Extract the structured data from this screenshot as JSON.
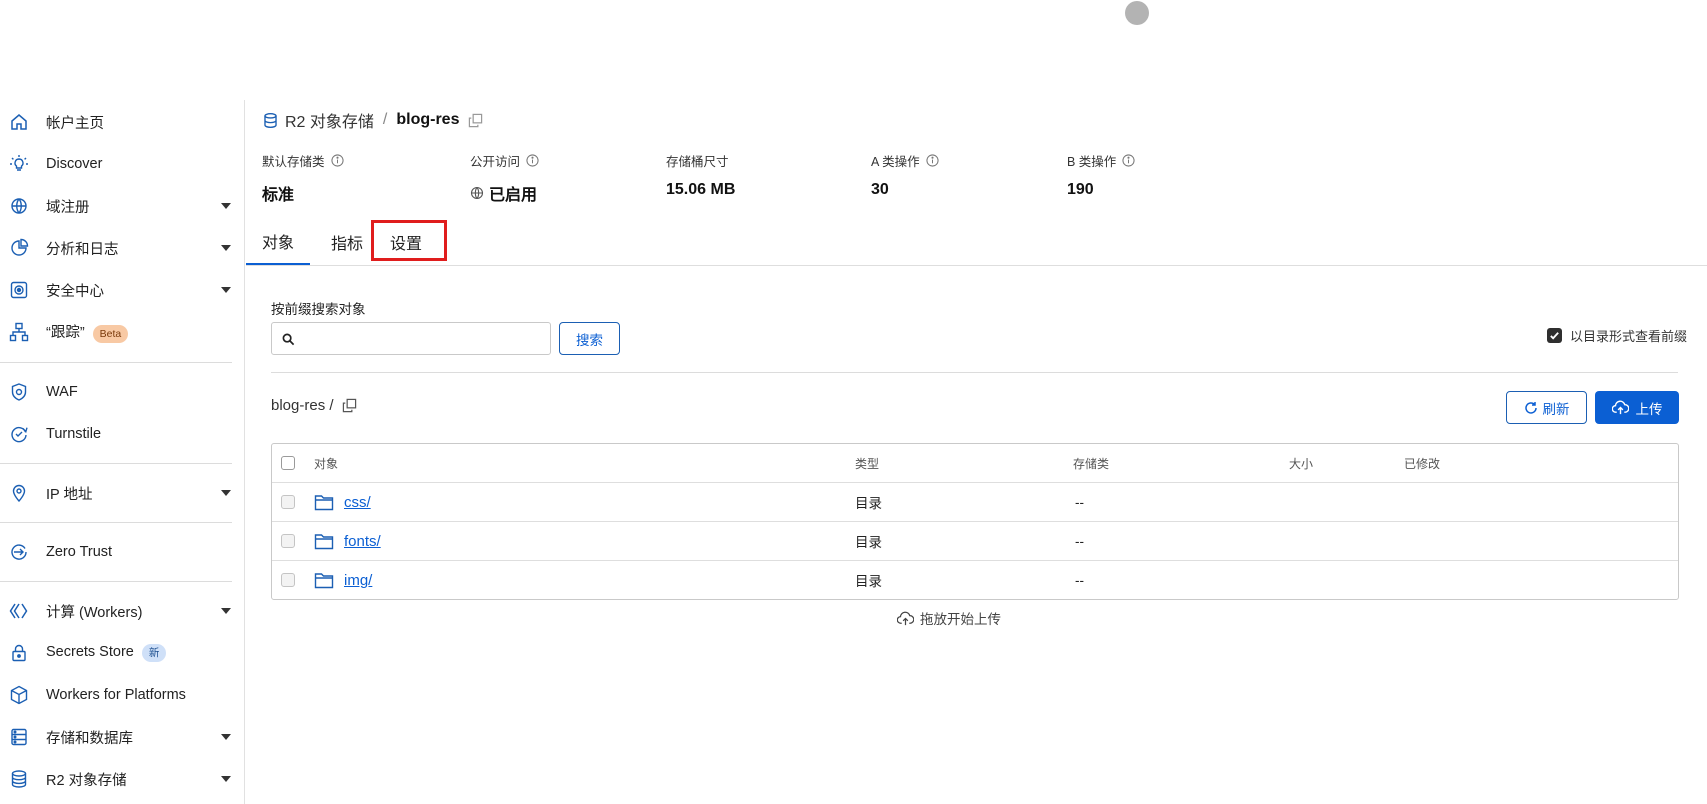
{
  "sidebar": {
    "items": [
      {
        "label": "帐户主页",
        "icon": "home-icon"
      },
      {
        "label": "Discover",
        "icon": "lightbulb-icon"
      },
      {
        "label": "域注册",
        "icon": "globe-icon"
      },
      {
        "label": "分析和日志",
        "icon": "pie-chart-icon"
      },
      {
        "label": "安全中心",
        "icon": "security-center-icon"
      },
      {
        "label": "“跟踪”",
        "icon": "network-icon",
        "badge": "Beta"
      },
      {
        "label": "WAF",
        "icon": "shield-icon"
      },
      {
        "label": "Turnstile",
        "icon": "turnstile-icon"
      },
      {
        "label": "IP 地址",
        "icon": "location-pin-icon"
      },
      {
        "label": "Zero Trust",
        "icon": "zero-trust-icon"
      },
      {
        "label": "计算 (Workers)",
        "icon": "workers-icon"
      },
      {
        "label": "Secrets Store",
        "icon": "lock-icon",
        "badge": "新"
      },
      {
        "label": "Workers for Platforms",
        "icon": "cube-icon"
      },
      {
        "label": "存储和数据库",
        "icon": "database-icon"
      },
      {
        "label": "R2 对象存储",
        "icon": "r2-storage-icon"
      }
    ]
  },
  "breadcrumb": {
    "parent": "R2 对象存储",
    "separator": "/",
    "current": "blog-res"
  },
  "stats": [
    {
      "label": "默认存储类",
      "value": "标准"
    },
    {
      "label": "公开访问",
      "value": "已启用"
    },
    {
      "label": "存储桶尺寸",
      "value": "15.06 MB"
    },
    {
      "label": "A 类操作",
      "value": "30"
    },
    {
      "label": "B 类操作",
      "value": "190"
    }
  ],
  "tabs": [
    "对象",
    "指标",
    "设置"
  ],
  "search": {
    "label": "按前缀搜索对象",
    "placeholder": "",
    "button": "搜索"
  },
  "dir_view_label": "以目录形式查看前缀",
  "path": "blog-res /",
  "actions": {
    "refresh": "刷新",
    "upload": "上传"
  },
  "table": {
    "columns": [
      "对象",
      "类型",
      "存储类",
      "大小",
      "已修改"
    ],
    "rows": [
      {
        "name": "css/",
        "type": "目录",
        "storage": "--"
      },
      {
        "name": "fonts/",
        "type": "目录",
        "storage": "--"
      },
      {
        "name": "img/",
        "type": "目录",
        "storage": "--"
      }
    ]
  },
  "drop_hint": "拖放开始上传",
  "colors": {
    "accent": "#0b5fd3",
    "highlight": "#e01d1d",
    "beta_badge": "#f8c9a4",
    "new_badge": "#cfe0f8"
  }
}
